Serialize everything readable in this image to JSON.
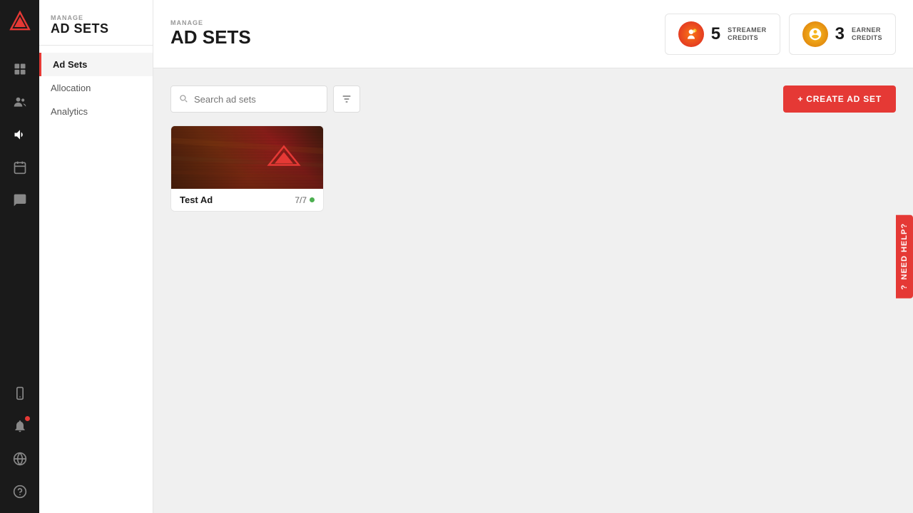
{
  "app": {
    "logo_alt": "App Logo"
  },
  "icon_sidebar": {
    "icons": [
      {
        "name": "dashboard-icon",
        "symbol": "⊞",
        "active": false
      },
      {
        "name": "users-icon",
        "symbol": "👥",
        "active": false
      },
      {
        "name": "megaphone-icon",
        "symbol": "📢",
        "active": true
      },
      {
        "name": "calendar-icon",
        "symbol": "📅",
        "active": false
      },
      {
        "name": "chat-icon",
        "symbol": "💬",
        "active": false
      },
      {
        "name": "mobile-icon",
        "symbol": "📱",
        "active": false
      },
      {
        "name": "globe-icon",
        "symbol": "🌐",
        "active": false
      },
      {
        "name": "help-icon",
        "symbol": "?",
        "active": false
      }
    ]
  },
  "sec_sidebar": {
    "manage_label": "MANAGE",
    "section_title": "AD SETS",
    "nav_items": [
      {
        "label": "Ad Sets",
        "active": true
      },
      {
        "label": "Allocation",
        "active": false
      },
      {
        "label": "Analytics",
        "active": false
      }
    ]
  },
  "top_bar": {
    "manage_label": "MANAGE",
    "page_title": "AD SETS",
    "credits": [
      {
        "type": "streamer",
        "count": "5",
        "label_line1": "STREAMER",
        "label_line2": "CREDITS",
        "icon": "💰"
      },
      {
        "type": "earner",
        "count": "3",
        "label_line1": "EARNER",
        "label_line2": "CREDITS",
        "icon": "🦁"
      }
    ]
  },
  "toolbar": {
    "search_placeholder": "Search ad sets",
    "create_button_label": "+ CREATE AD SET"
  },
  "ad_cards": [
    {
      "name": "Test Ad",
      "status": "7/7",
      "status_color": "green"
    }
  ],
  "need_help": {
    "label": "Need Help?",
    "icon": "?"
  }
}
